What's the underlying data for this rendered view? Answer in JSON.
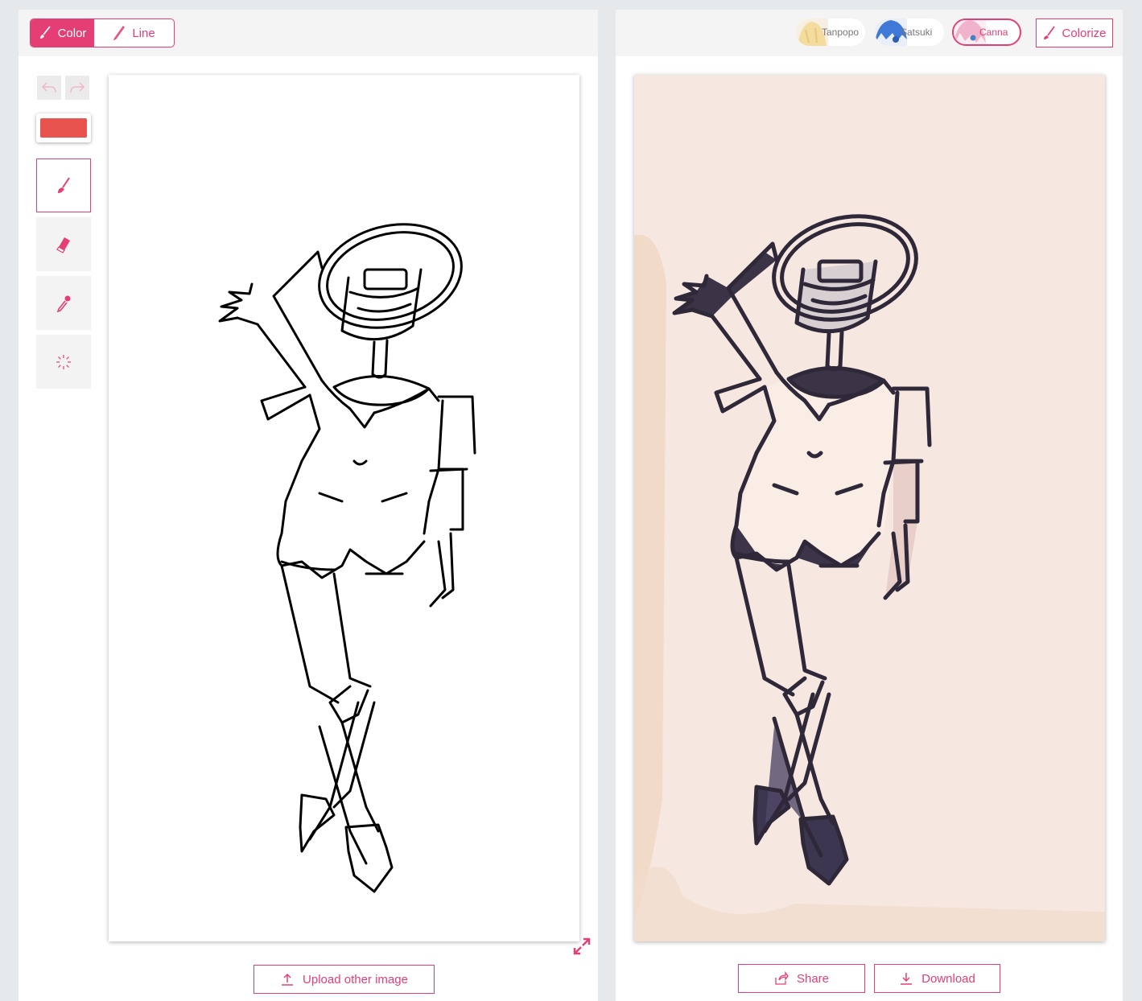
{
  "left_panel": {
    "mode_toggle": {
      "color_label": "Color",
      "line_label": "Line",
      "active": "Color"
    },
    "tools": {
      "undo_icon": "undo-icon",
      "redo_icon": "redo-icon",
      "current_color": "#e9534d",
      "items": [
        {
          "name": "brush-tool",
          "icon": "brush-icon",
          "selected": true
        },
        {
          "name": "eraser-tool",
          "icon": "eraser-icon",
          "selected": false
        },
        {
          "name": "eyedropper-tool",
          "icon": "eyedropper-icon",
          "selected": false
        },
        {
          "name": "loading-tool",
          "icon": "spinner-icon",
          "selected": false
        }
      ]
    },
    "upload_label": "Upload other image"
  },
  "right_panel": {
    "styles": [
      {
        "label": "Tanpopo",
        "selected": false
      },
      {
        "label": "Satsuki",
        "selected": false
      },
      {
        "label": "Canna",
        "selected": true
      }
    ],
    "colorize_label": "Colorize",
    "share_label": "Share",
    "download_label": "Download"
  },
  "colors": {
    "accent": "#e53e75",
    "result_background": "#f6e8e0"
  }
}
